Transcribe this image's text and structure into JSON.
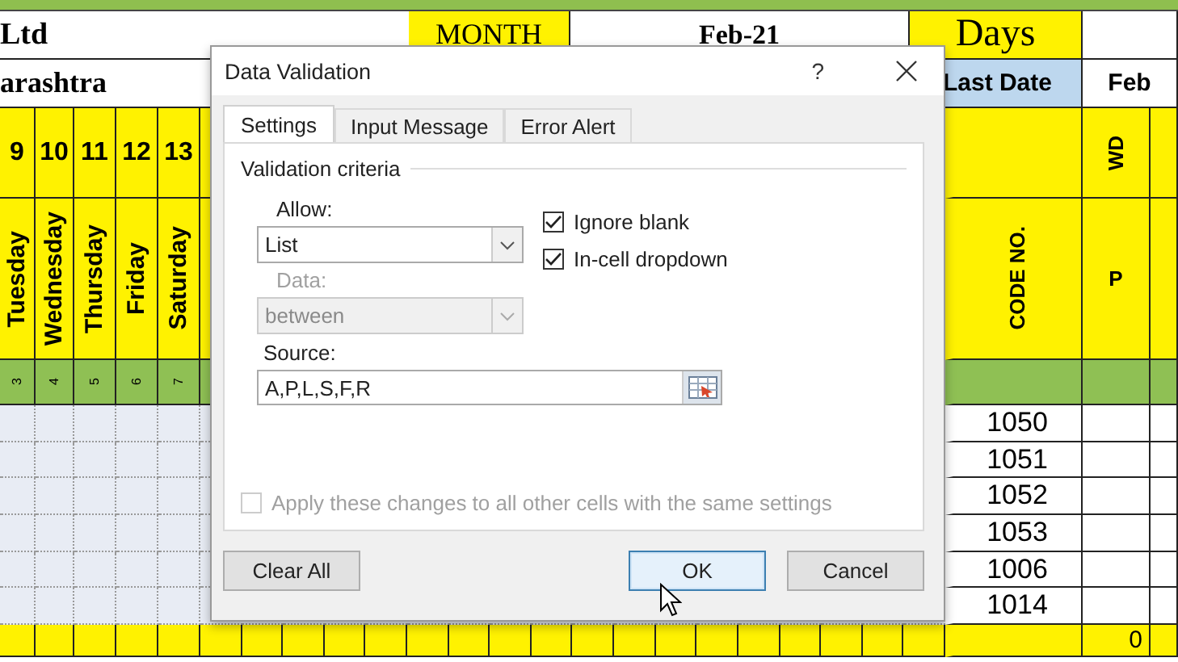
{
  "sheet": {
    "company": "Ltd",
    "month_label": "MONTH",
    "month": "Feb-21",
    "days_label": "Days",
    "location": "arashtra",
    "last_date_label": "Last Date",
    "last_date": "Feb",
    "day_columns": [
      {
        "number": "9",
        "weekday": "Tuesday",
        "serial": "3"
      },
      {
        "number": "10",
        "weekday": "Wednesday",
        "serial": "4"
      },
      {
        "number": "11",
        "weekday": "Thursday",
        "serial": "5"
      },
      {
        "number": "12",
        "weekday": "Friday",
        "serial": "6"
      },
      {
        "number": "13",
        "weekday": "Saturday",
        "serial": "7"
      }
    ],
    "code_header": "CODE NO.",
    "wd_header": "WD",
    "p_header": "P",
    "rows": [
      {
        "code": "1050"
      },
      {
        "code": "1051"
      },
      {
        "code": "1052"
      },
      {
        "code": "1053"
      },
      {
        "code": "1006"
      },
      {
        "code": "1014"
      }
    ],
    "total": "0"
  },
  "dialog": {
    "title": "Data Validation",
    "help": "?",
    "tabs": [
      {
        "label": "Settings",
        "selected": true
      },
      {
        "label": "Input Message",
        "selected": false
      },
      {
        "label": "Error Alert",
        "selected": false
      }
    ],
    "group_title": "Validation criteria",
    "allow": {
      "label": "Allow:",
      "value": "List"
    },
    "data": {
      "label": "Data:",
      "value": "between",
      "disabled": true
    },
    "source": {
      "label": "Source:",
      "value": "A,P,L,S,F,R"
    },
    "options": [
      {
        "label": "Ignore blank",
        "checked": true
      },
      {
        "label": "In-cell dropdown",
        "checked": true
      }
    ],
    "apply": {
      "label": "Apply these changes to all other cells with the same settings",
      "checked": false,
      "disabled": true
    },
    "buttons": [
      {
        "label": "Clear All",
        "kind": "normal"
      },
      {
        "label": "OK",
        "kind": "default"
      },
      {
        "label": "Cancel",
        "kind": "normal"
      }
    ]
  }
}
